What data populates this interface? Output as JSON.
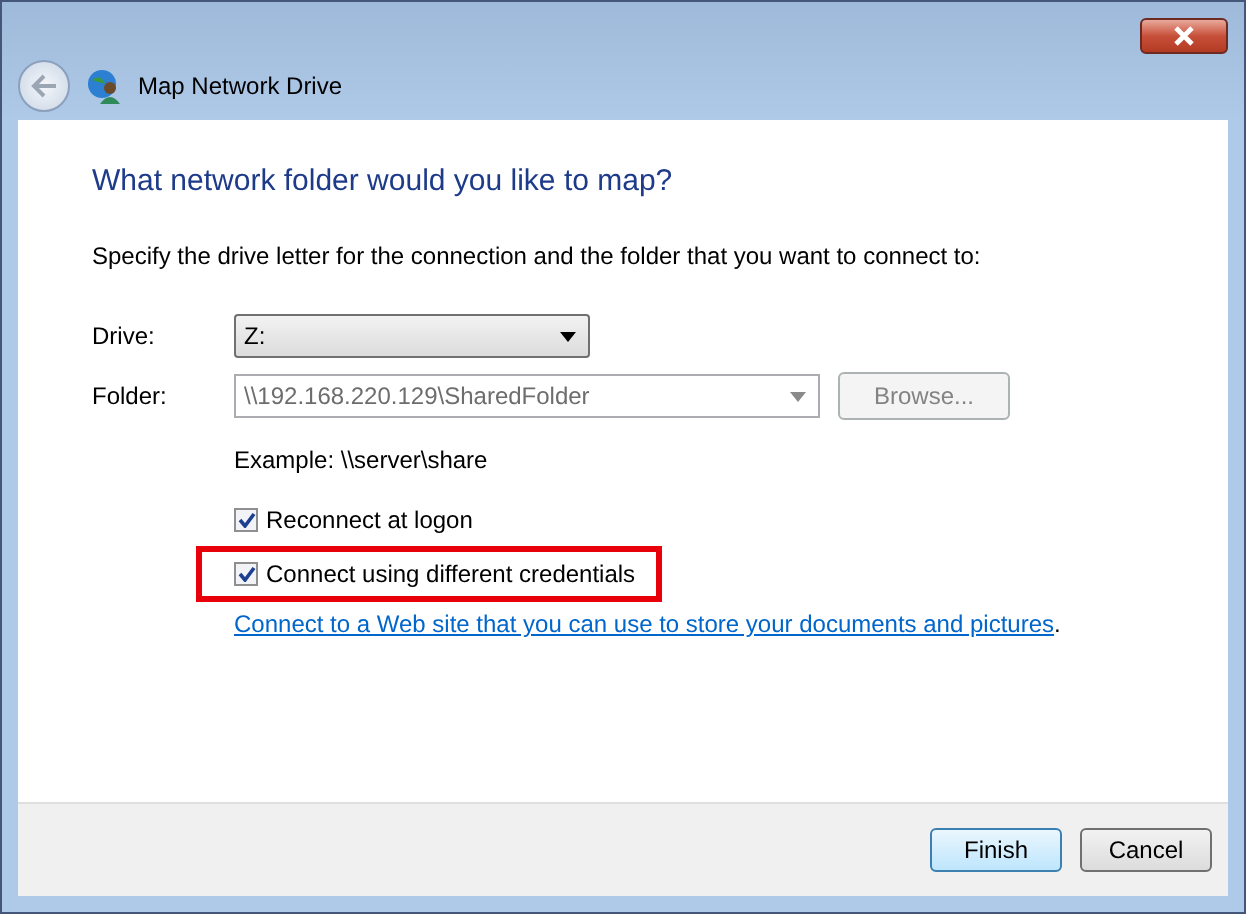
{
  "window": {
    "title": "Map Network Drive"
  },
  "heading": "What network folder would you like to map?",
  "instruction": "Specify the drive letter for the connection and the folder that you want to connect to:",
  "drive": {
    "label": "Drive:",
    "value": "Z:"
  },
  "folder": {
    "label": "Folder:",
    "value": "\\\\192.168.220.129\\SharedFolder",
    "disabled": true,
    "browse": {
      "label": "Browse...",
      "disabled": true
    }
  },
  "example": "Example: \\\\server\\share",
  "options": [
    {
      "label": "Reconnect at logon",
      "checked": true,
      "highlighted": false
    },
    {
      "label": "Connect using different credentials",
      "checked": true,
      "highlighted": true
    }
  ],
  "link": "Connect to a Web site that you can use to store your documents and pictures",
  "link_suffix": ".",
  "buttons": [
    {
      "label": "Finish",
      "selected": true
    },
    {
      "label": "Cancel",
      "selected": false
    }
  ]
}
